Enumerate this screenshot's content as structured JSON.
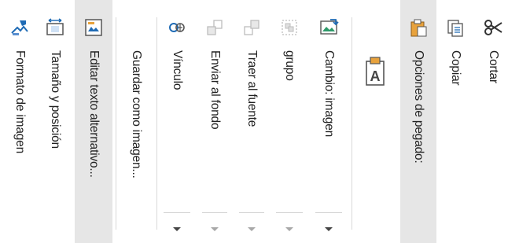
{
  "menu": {
    "items": [
      {
        "label": "Formato de imagen"
      },
      {
        "label": "Tamaño y posición"
      },
      {
        "label": "Editar texto alternativo..."
      },
      {
        "label": "Guardar como imagen..."
      },
      {
        "label": "Vínculo"
      },
      {
        "label": "Enviar al fondo"
      },
      {
        "label": "Traer al fuente"
      },
      {
        "label": "grupo"
      },
      {
        "label": "Cambio: imagen"
      },
      {
        "label": "Opciones de pegado:"
      },
      {
        "label": "Copiar"
      },
      {
        "label": "Cortar"
      }
    ]
  },
  "colors": {
    "hover_bg": "#e6e6e6",
    "icon_blue": "#1f6bb5",
    "icon_orange": "#e8a23c",
    "disabled": "#bdbdbd"
  }
}
